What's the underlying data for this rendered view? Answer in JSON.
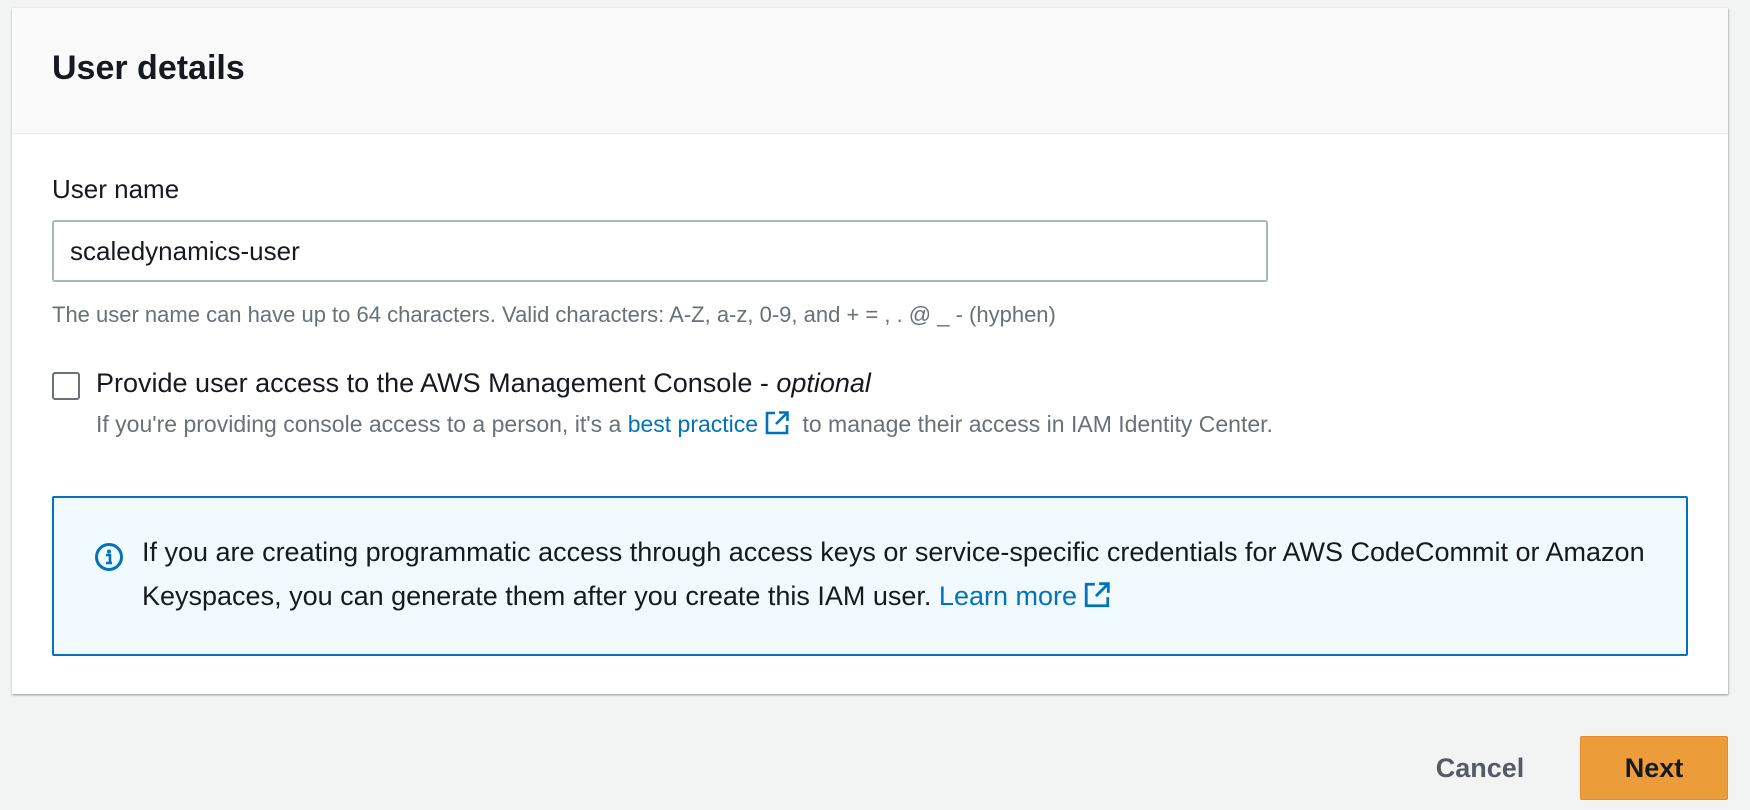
{
  "card": {
    "title": "User details"
  },
  "user_name": {
    "label": "User name",
    "value": "scaledynamics-user",
    "constraint": "The user name can have up to 64 characters. Valid characters: A-Z, a-z, 0-9, and + = , . @ _ - (hyphen)"
  },
  "console_access": {
    "checked": false,
    "label": "Provide user access to the AWS Management Console - ",
    "label_optional": "optional",
    "desc_before": "If you're providing console access to a person, it's a ",
    "desc_link": "best practice",
    "desc_after": " to manage their access in IAM Identity Center.",
    "link_icon": "external-link-icon"
  },
  "info_alert": {
    "icon": "info-icon",
    "text": "If you are creating programmatic access through access keys or service-specific credentials for AWS CodeCommit or Amazon Keyspaces, you can generate them after you create this IAM user. ",
    "link": "Learn more",
    "link_icon": "external-link-icon"
  },
  "footer": {
    "cancel_label": "Cancel",
    "next_label": "Next"
  },
  "colors": {
    "link": "#0073bb",
    "primary_button": "#ec9d3a",
    "alert_background": "#f1faff",
    "alert_border": "#0073bb"
  }
}
